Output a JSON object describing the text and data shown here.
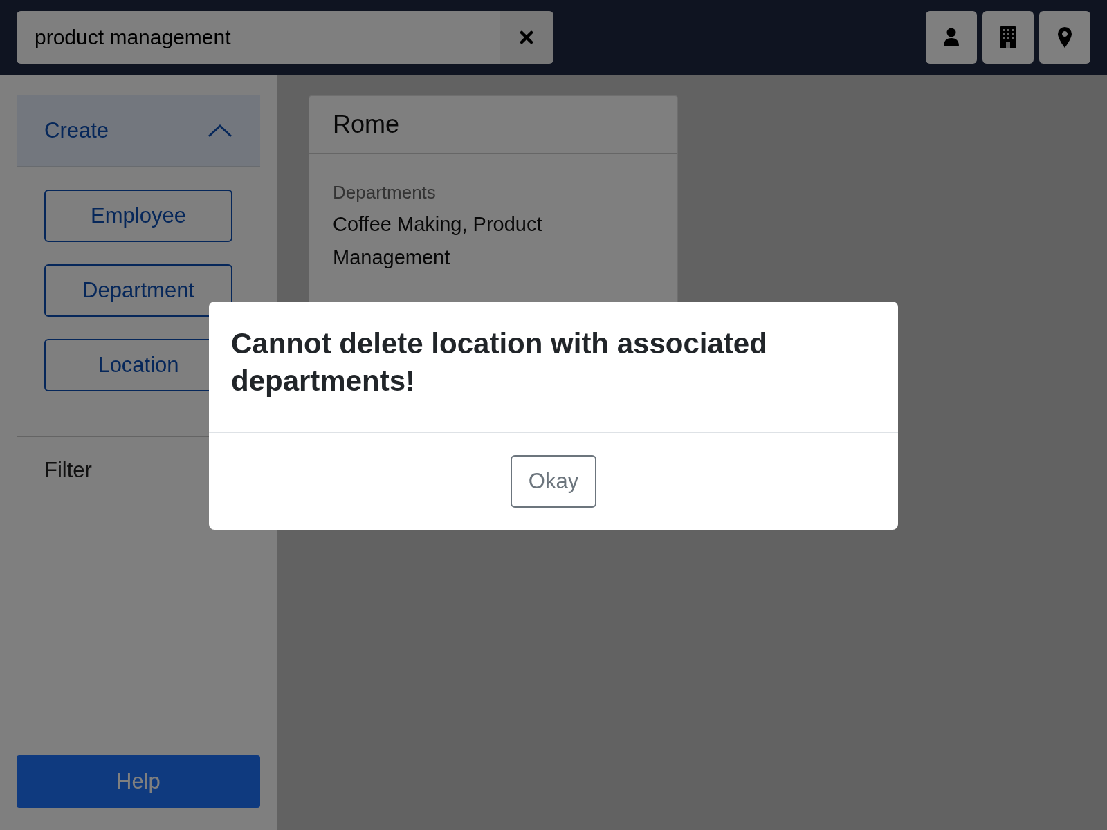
{
  "search": {
    "value": "product management"
  },
  "sidebar": {
    "create": {
      "label": "Create",
      "expanded": true,
      "buttons": [
        "Employee",
        "Department",
        "Location"
      ]
    },
    "filter": {
      "label": "Filter"
    },
    "help": "Help"
  },
  "card": {
    "title": "Rome",
    "fields": [
      {
        "label": "Departments",
        "value": "Coffee Making, Product Management"
      }
    ]
  },
  "modal": {
    "message": "Cannot delete location with associated departments!",
    "button": "Okay"
  }
}
